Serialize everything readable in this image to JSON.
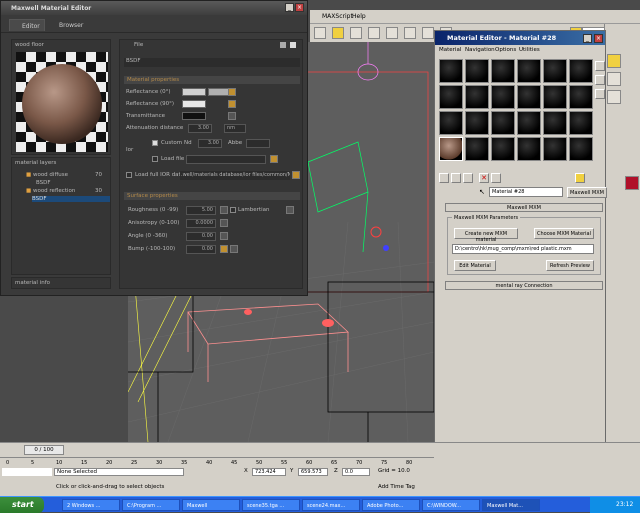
{
  "max_menu": {
    "items": [
      "MAXScript",
      "Help"
    ]
  },
  "max_toolbar": {
    "view_label": "View"
  },
  "maxwell_editor": {
    "title": "Maxwell Material Editor",
    "tabs": [
      "Editor",
      "Browser"
    ],
    "preview_label": "wood floor",
    "file_menu": "File",
    "bsdf_name": "BSDF",
    "material_properties_header": "Material properties",
    "reflectance0_label": "Reflectance (0°)",
    "reflectance90_label": "Reflectance (90°)",
    "transmittance_label": "Transmittance",
    "attenuation_label": "Attenuation distance",
    "attenuation_value": "3.00",
    "attenuation_unit": "nm",
    "ior_label": "Ior",
    "custom_label": "Custom",
    "nd_label": "Nd",
    "nd_value": "3.00",
    "abbe_label": "Abbe",
    "loadfile_label": "Load file",
    "loadior_label": "Load full IOR data",
    "loadior_path": ".well/materials database/ior files/common/N.ior",
    "surface_header": "Surface properties",
    "roughness_label": "Roughness (0 -99)",
    "roughness_value": "5.00",
    "lambertian_label": "Lambertian",
    "anisotropy_label": "Anisotropy (0-100)",
    "anisotropy_value": "0.0000",
    "angle_label": "Angle (0 -360)",
    "angle_value": "0.00",
    "bump_label": "Bump (-100-100)",
    "bump_value": "0.00",
    "layers_label": "material layers",
    "layers": [
      {
        "name": "wood diffuse",
        "weight": "70"
      },
      {
        "name": "BSDF",
        "weight": ""
      },
      {
        "name": "wood reflection",
        "weight": "30"
      },
      {
        "name": "BSDF",
        "weight": ""
      }
    ],
    "info_label": "material info"
  },
  "material_editor": {
    "title": "Material Editor - Material #28",
    "menu": [
      "Material",
      "Navigation",
      "Options",
      "Utilities"
    ],
    "material_name": "Material #28",
    "type_button": "Maxwell MXM",
    "rollout_maxwell": "Maxwell MXM",
    "params_group": "Maxwell MXM Parameters",
    "create_button": "Create new MXM material",
    "choose_button": "Choose MXM Material",
    "mxm_path": "D:\\centro\\hk\\mug_comp\\mxm\\red plastic.mxm",
    "edit_button": "Edit Material",
    "refresh_button": "Refresh Preview",
    "rollout_mentalray": "mental ray Connection"
  },
  "timeline": {
    "frame_label": "0 / 100",
    "ticks": [
      "0",
      "5",
      "10",
      "15",
      "20",
      "25",
      "30",
      "35",
      "40",
      "45",
      "50",
      "55",
      "60",
      "65",
      "70",
      "75",
      "80"
    ]
  },
  "status_bar": {
    "selection": "None Selected",
    "prompt": "Click or click-and-drag to select objects",
    "x_label": "X",
    "x_value": "723.424",
    "y_label": "Y",
    "y_value": "659.573",
    "z_label": "Z",
    "z_value": "0.0",
    "grid": "Grid = 10.0",
    "add_time_tag": "Add Time Tag"
  },
  "taskbar": {
    "start": "start",
    "tasks": [
      "2 Windows ...",
      "C:\\Program ...",
      "Maxwell",
      "scene35.tga ...",
      "scene24.max...",
      "Adobe Photo...",
      "C:\\WINDOW...",
      "Maxwell Mat..."
    ],
    "clock": "23:12"
  }
}
